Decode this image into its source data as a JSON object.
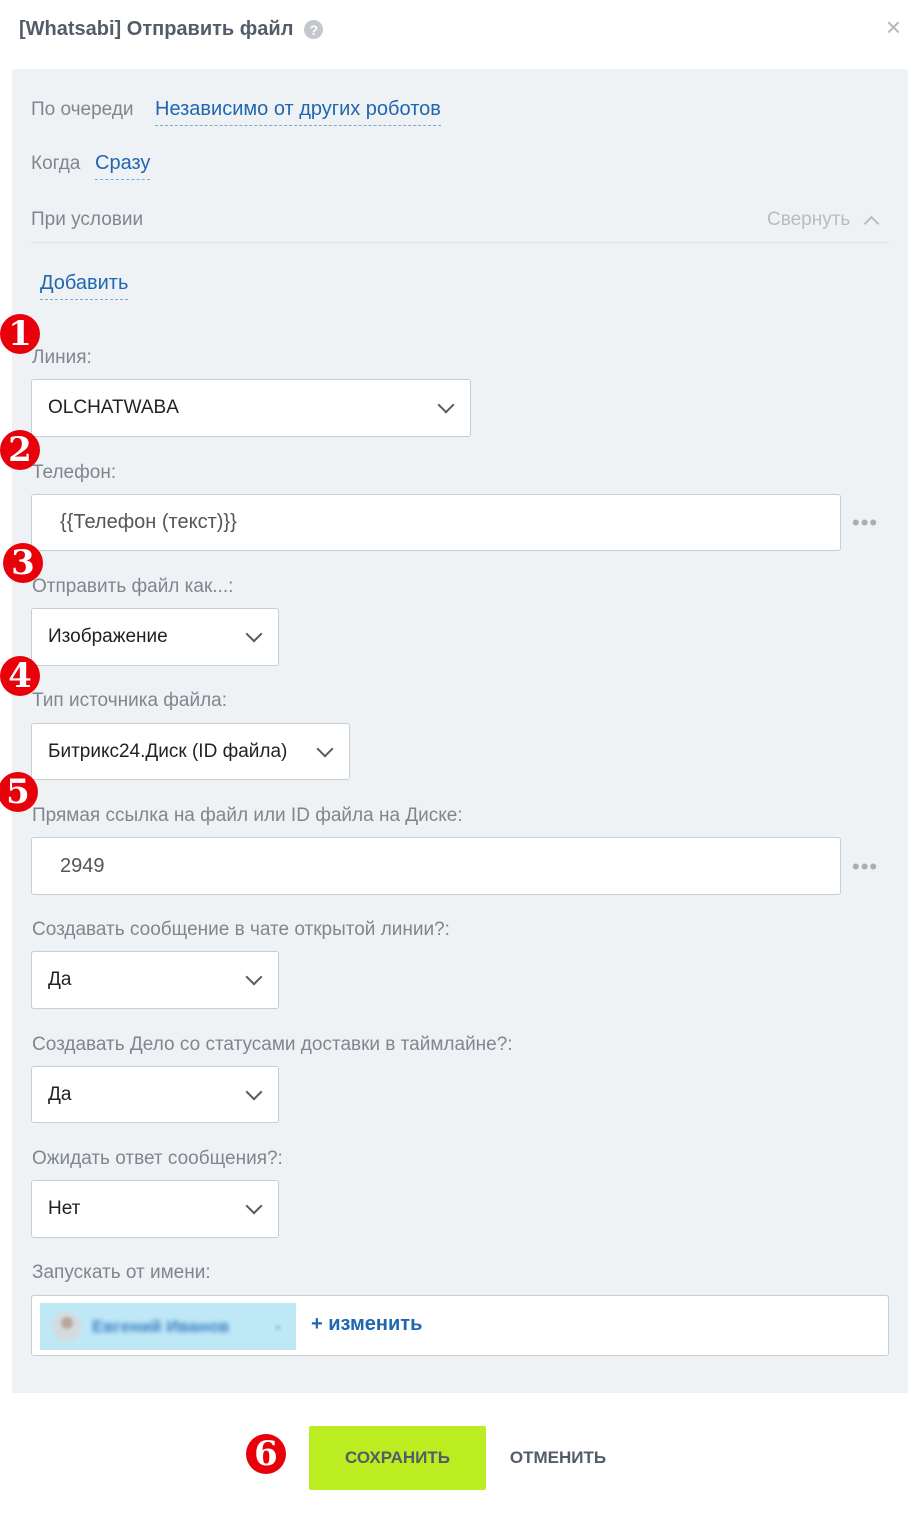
{
  "dialog": {
    "title": "[Whatsabi] Отправить файл",
    "help_glyph": "?",
    "close_glyph": "×"
  },
  "queue": {
    "label": "По очереди",
    "value": "Независимо от других роботов"
  },
  "when": {
    "label": "Когда",
    "value": "Сразу"
  },
  "condition": {
    "label": "При условии",
    "collapse_label": "Свернуть",
    "add_label": "Добавить"
  },
  "badges": [
    "1",
    "2",
    "3",
    "4",
    "5",
    "6"
  ],
  "fields": {
    "line": {
      "label": "Линия:",
      "value": "OLCHATWABA"
    },
    "phone": {
      "label": "Телефон:",
      "value": "{{Телефон (текст)}}"
    },
    "send_as": {
      "label": "Отправить файл как...:",
      "value": "Изображение"
    },
    "source_type": {
      "label": "Тип источника файла:",
      "value": "Битрикс24.Диск (ID файла)"
    },
    "file_ref": {
      "label": "Прямая ссылка на файл или ID файла на Диске:",
      "value": "2949"
    },
    "create_message": {
      "label": "Создавать сообщение в чате открытой линии?:",
      "value": "Да"
    },
    "create_deal": {
      "label": "Создавать Дело со статусами доставки в таймлайне?:",
      "value": "Да"
    },
    "wait_reply": {
      "label": "Ожидать ответ сообщения?:",
      "value": "Нет"
    },
    "run_as": {
      "label": "Запускать от имени:",
      "user_name": "Евгений Иванов",
      "chip_close": "×",
      "change_label": "+ изменить"
    }
  },
  "dots_glyph": "•••",
  "footer": {
    "save_label": "СОХРАНИТЬ",
    "cancel_label": "ОТМЕНИТЬ"
  },
  "colors": {
    "accent": "#2067b0",
    "save_button": "#bbed21",
    "badge": "#e8000b",
    "panel_bg": "#eef2f4"
  }
}
